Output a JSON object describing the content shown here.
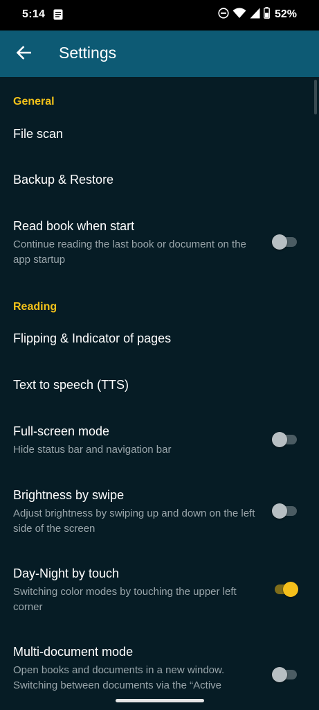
{
  "status": {
    "time": "5:14",
    "battery_pct": "52%",
    "icons": [
      "notification-icon",
      "dnd-icon",
      "wifi-icon",
      "cell-signal-icon",
      "battery-icon"
    ]
  },
  "appbar": {
    "title": "Settings",
    "back_icon": "arrow-back-icon",
    "color": "#0d5a74"
  },
  "colors": {
    "accent": "#f2c21a",
    "background": "#061c25",
    "switch_on": "#f4bf1b"
  },
  "general": {
    "header": "General",
    "file_scan": "File scan",
    "backup_restore": "Backup & Restore",
    "read_book": {
      "title": "Read book when start",
      "subtitle": "Continue reading the last book or document on the app startup",
      "enabled": false
    }
  },
  "reading": {
    "header": "Reading",
    "flipping": "Flipping & Indicator of pages",
    "tts": "Text to speech (TTS)",
    "fullscreen": {
      "title": "Full-screen mode",
      "subtitle": "Hide status bar and navigation bar",
      "enabled": false
    },
    "brightness": {
      "title": "Brightness by swipe",
      "subtitle": "Adjust brightness by swiping up and down on the left side of the screen",
      "enabled": false
    },
    "day_night": {
      "title": "Day-Night by touch",
      "subtitle": "Switching color modes by touching the upper left corner",
      "enabled": true
    },
    "multi_doc": {
      "title": "Multi-document mode",
      "subtitle": "Open books and documents in a new window. Switching between documents via the “Active",
      "enabled": false
    }
  }
}
